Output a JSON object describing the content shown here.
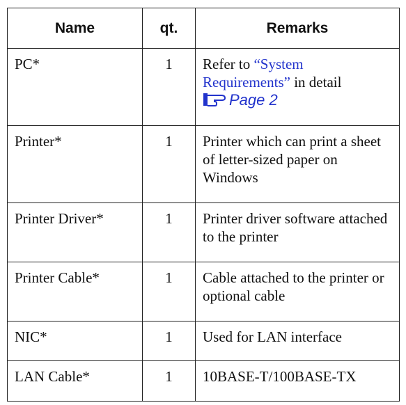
{
  "table": {
    "headers": {
      "name": "Name",
      "qt": "qt.",
      "remarks": "Remarks"
    },
    "rows": [
      {
        "name": "PC*",
        "qt": "1",
        "remarks_prefix": "Refer to ",
        "remarks_link": "“System Requirements”",
        "remarks_suffix": " in detail",
        "page_ref_icon": "pointing-hand-icon",
        "page_ref": "Page 2"
      },
      {
        "name": "Printer*",
        "qt": "1",
        "remarks": "Printer which can print a sheet of letter-sized paper on Windows"
      },
      {
        "name": "Printer Driver*",
        "qt": "1",
        "remarks": "Printer driver software attached to the printer"
      },
      {
        "name": "Printer Cable*",
        "qt": "1",
        "remarks": "Cable attached to the printer or optional cable"
      },
      {
        "name": "NIC*",
        "qt": "1",
        "remarks": "Used for LAN interface"
      },
      {
        "name": "LAN Cable*",
        "qt": "1",
        "remarks": "10BASE-T/100BASE-TX"
      }
    ]
  },
  "colors": {
    "link": "#2233cc",
    "text": "#111111",
    "border": "#222222"
  }
}
